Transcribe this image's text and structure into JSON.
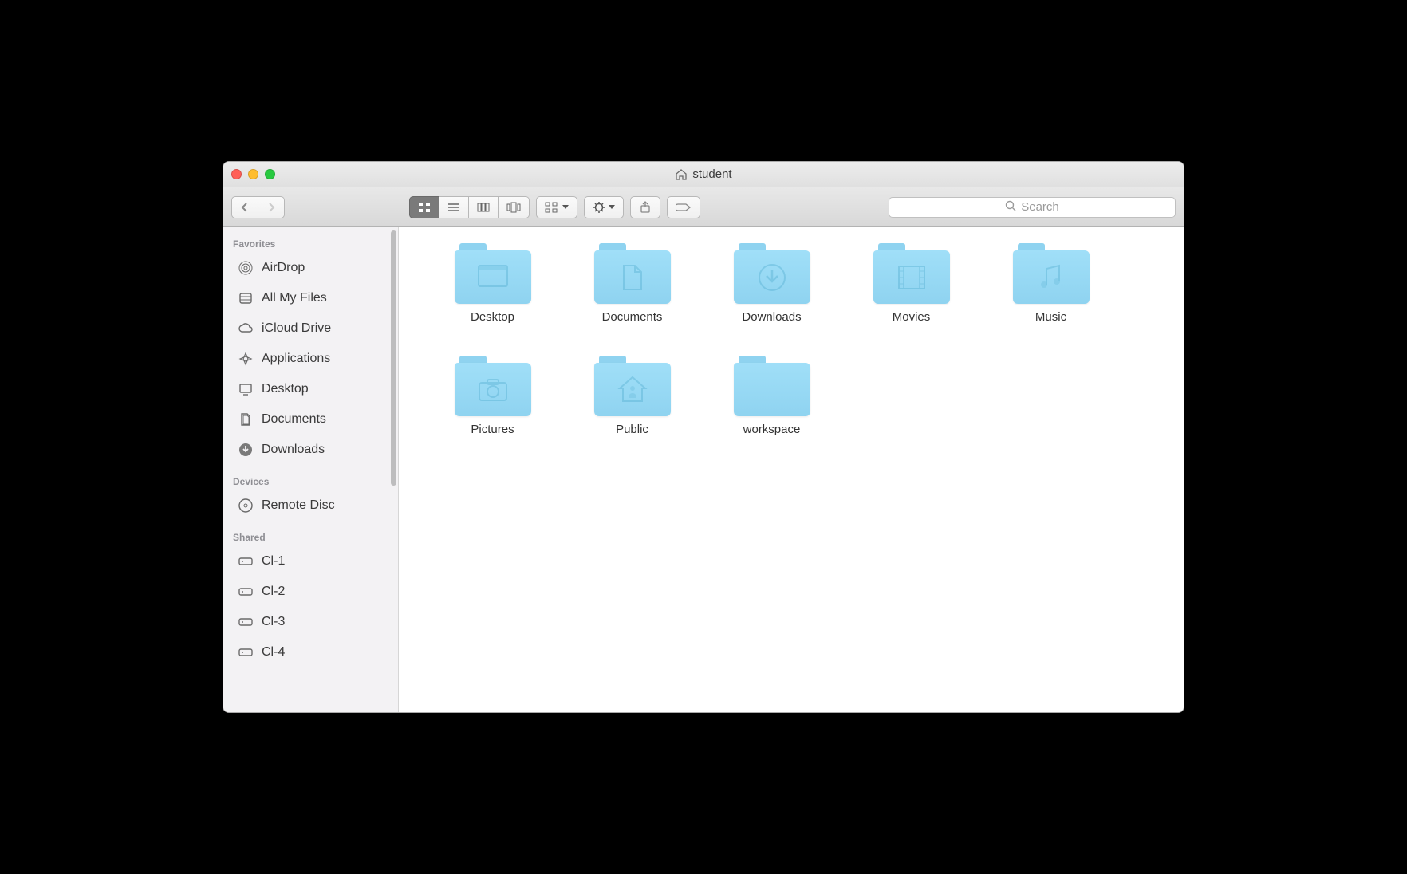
{
  "window": {
    "title": "student"
  },
  "toolbar": {
    "view_modes": [
      "icon",
      "list",
      "column",
      "coverflow"
    ],
    "active_view": 0
  },
  "search": {
    "placeholder": "Search"
  },
  "sidebar": {
    "sections": [
      {
        "title": "Favorites",
        "items": [
          {
            "label": "AirDrop",
            "icon": "airdrop"
          },
          {
            "label": "All My Files",
            "icon": "allfiles"
          },
          {
            "label": "iCloud Drive",
            "icon": "cloud"
          },
          {
            "label": "Applications",
            "icon": "apps"
          },
          {
            "label": "Desktop",
            "icon": "desktop"
          },
          {
            "label": "Documents",
            "icon": "documents"
          },
          {
            "label": "Downloads",
            "icon": "downloads"
          }
        ]
      },
      {
        "title": "Devices",
        "items": [
          {
            "label": "Remote Disc",
            "icon": "disc"
          }
        ]
      },
      {
        "title": "Shared",
        "items": [
          {
            "label": "Cl-1",
            "icon": "server"
          },
          {
            "label": "Cl-2",
            "icon": "server"
          },
          {
            "label": "Cl-3",
            "icon": "server"
          },
          {
            "label": "Cl-4",
            "icon": "server"
          }
        ]
      }
    ]
  },
  "folders": [
    {
      "label": "Desktop",
      "type": "desktop"
    },
    {
      "label": "Documents",
      "type": "document"
    },
    {
      "label": "Downloads",
      "type": "download"
    },
    {
      "label": "Movies",
      "type": "movies"
    },
    {
      "label": "Music",
      "type": "music"
    },
    {
      "label": "Pictures",
      "type": "pictures"
    },
    {
      "label": "Public",
      "type": "public"
    },
    {
      "label": "workspace",
      "type": "plain"
    }
  ]
}
